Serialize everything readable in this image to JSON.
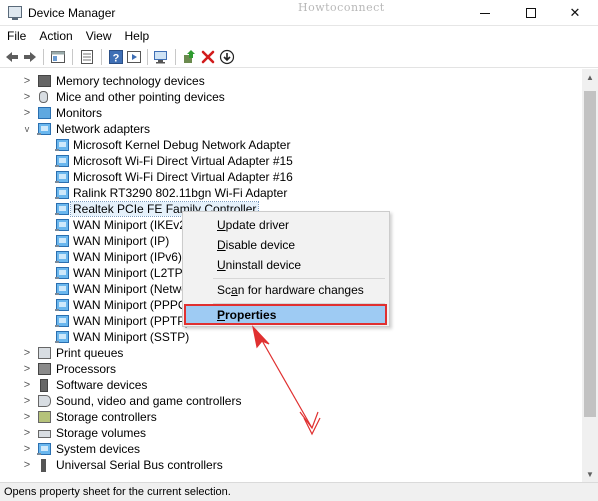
{
  "window": {
    "title": "Device Manager",
    "watermark": "Howtoconnect",
    "controls": {
      "minimize": "",
      "maximize": "",
      "close": "✕"
    }
  },
  "menu": [
    "File",
    "Action",
    "View",
    "Help"
  ],
  "toolbar": {
    "icons": [
      "back-icon",
      "forward-icon",
      "show-hide-console-tree-icon",
      "properties-icon",
      "help-icon",
      "run-action-icon",
      "scan-hardware-icon",
      "update-driver-icon",
      "uninstall-icon",
      "download-icon"
    ]
  },
  "tree": {
    "rows": [
      {
        "label": "Memory technology devices",
        "expander": ">",
        "icon": "memory-chip-icon"
      },
      {
        "label": "Mice and other pointing devices",
        "expander": ">",
        "icon": "mouse-icon"
      },
      {
        "label": "Monitors",
        "expander": ">",
        "icon": "monitor-icon"
      },
      {
        "label": "Network adapters",
        "expander": "v",
        "icon": "network-adapter-icon"
      },
      {
        "label": "Microsoft Kernel Debug Network Adapter",
        "icon": "network-card-icon"
      },
      {
        "label": "Microsoft Wi-Fi Direct Virtual Adapter #15",
        "icon": "network-card-icon"
      },
      {
        "label": "Microsoft Wi-Fi Direct Virtual Adapter #16",
        "icon": "network-card-icon"
      },
      {
        "label": "Ralink RT3290 802.11bgn Wi-Fi Adapter",
        "icon": "network-card-icon"
      },
      {
        "label": "Realtek PCIe FE Family Controller",
        "icon": "network-card-icon",
        "selected": true
      },
      {
        "label": "WAN Miniport (IKEv2)",
        "icon": "network-card-icon"
      },
      {
        "label": "WAN Miniport (IP)",
        "icon": "network-card-icon"
      },
      {
        "label": "WAN Miniport (IPv6)",
        "icon": "network-card-icon"
      },
      {
        "label": "WAN Miniport (L2TP)",
        "icon": "network-card-icon"
      },
      {
        "label": "WAN Miniport (Network",
        "icon": "network-card-icon"
      },
      {
        "label": "WAN Miniport (PPPOE)",
        "icon": "network-card-icon"
      },
      {
        "label": "WAN Miniport (PPTP)",
        "icon": "network-card-icon"
      },
      {
        "label": "WAN Miniport (SSTP)",
        "icon": "network-card-icon"
      },
      {
        "label": "Print queues",
        "expander": ">",
        "icon": "printer-icon"
      },
      {
        "label": "Processors",
        "expander": ">",
        "icon": "processor-icon"
      },
      {
        "label": "Software devices",
        "expander": ">",
        "icon": "software-device-icon"
      },
      {
        "label": "Sound, video and game controllers",
        "expander": ">",
        "icon": "speaker-icon"
      },
      {
        "label": "Storage controllers",
        "expander": ">",
        "icon": "storage-controller-icon"
      },
      {
        "label": "Storage volumes",
        "expander": ">",
        "icon": "storage-volume-icon"
      },
      {
        "label": "System devices",
        "expander": ">",
        "icon": "system-device-icon"
      },
      {
        "label": "Universal Serial Bus controllers",
        "expander": ">",
        "icon": "usb-icon"
      }
    ]
  },
  "context_menu": {
    "update_driver": {
      "accel": "U",
      "rest": "pdate driver"
    },
    "disable_device": {
      "accel": "D",
      "rest": "isable device"
    },
    "uninstall_device": {
      "accel": "U",
      "rest": "ninstall device"
    },
    "scan_hardware": {
      "pre": "Sc",
      "accel": "a",
      "rest": "n for hardware changes"
    },
    "properties": {
      "accel": "P",
      "rest": "roperties"
    }
  },
  "status": {
    "text": "Opens property sheet for the current selection."
  },
  "colors": {
    "highlight": "#9ecbf3",
    "annotation": "#e03030",
    "selection": "#e5f1fb"
  }
}
